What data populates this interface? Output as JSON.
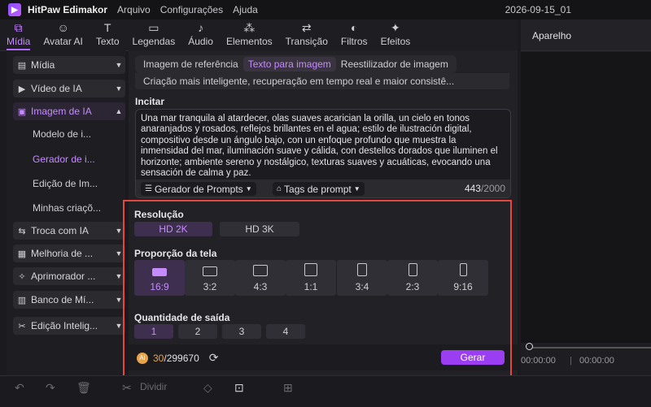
{
  "app": {
    "name": "HitPaw Edimakor",
    "menu": [
      "Arquivo",
      "Configurações",
      "Ajuda"
    ],
    "project": "2026-09-15_01"
  },
  "toolbar": [
    {
      "label": "Mídia",
      "icon": "media-icon",
      "active": true
    },
    {
      "label": "Avatar AI",
      "icon": "avatar-icon"
    },
    {
      "label": "Texto",
      "icon": "text-icon"
    },
    {
      "label": "Legendas",
      "icon": "subtitles-icon"
    },
    {
      "label": "Áudio",
      "icon": "audio-icon"
    },
    {
      "label": "Elementos",
      "icon": "elements-icon"
    },
    {
      "label": "Transição",
      "icon": "transition-icon"
    },
    {
      "label": "Filtros",
      "icon": "filters-icon"
    },
    {
      "label": "Efeitos",
      "icon": "effects-icon"
    }
  ],
  "sidebar": {
    "items": [
      {
        "label": "Mídia",
        "icon": "folder-icon"
      },
      {
        "label": "Vídeo de IA",
        "icon": "video-icon"
      },
      {
        "label": "Imagem de IA",
        "icon": "image-icon",
        "active": true
      },
      {
        "label": "Troca com IA",
        "icon": "swap-icon"
      },
      {
        "label": "Melhoria de ...",
        "icon": "enhance-icon"
      },
      {
        "label": "Aprimorador ...",
        "icon": "sparkle-icon"
      },
      {
        "label": "Banco de Mí...",
        "icon": "library-icon"
      },
      {
        "label": "Edição Intelig...",
        "icon": "smart-edit-icon"
      }
    ],
    "subitems": [
      {
        "label": "Modelo de i..."
      },
      {
        "label": "Gerador de i...",
        "active": true
      },
      {
        "label": "Edição de Im..."
      },
      {
        "label": "Minhas criaçõ..."
      }
    ]
  },
  "main": {
    "tabs": [
      "Imagem de referência",
      "Texto para imagem",
      "Reestilizador de imagem"
    ],
    "active_tab": 1,
    "tip": "Criação mais inteligente, recuperação em tempo real e maior consistê...",
    "prompt_label": "Incitar",
    "prompt_text": "Una mar tranquila al atardecer, olas suaves acarician la orilla, un cielo en tonos anaranjados y rosados, reflejos brillantes en el agua; estilo de ilustración digital, compositivo desde un ángulo bajo, con un enfoque profundo que muestra la inmensidad del mar, iluminación suave y cálida, con destellos dorados que iluminen el horizonte; ambiente sereno y nostálgico, texturas suaves y acuáticas, evocando una sensación de calma y paz.",
    "prompt_generator": "Gerador de Prompts",
    "prompt_tags": "Tags de prompt",
    "char_count": "443",
    "char_max": "/2000",
    "resolution_label": "Resolução",
    "resolutions": [
      "HD 2K",
      "HD 3K"
    ],
    "resolution_selected": 0,
    "aspect_label": "Proporção da tela",
    "aspects": [
      "16:9",
      "3:2",
      "4:3",
      "1:1",
      "3:4",
      "2:3",
      "9:16"
    ],
    "aspect_selected": 0,
    "quantity_label": "Quantidade de saída",
    "quantities": [
      "1",
      "2",
      "3",
      "4"
    ],
    "quantity_selected": 0,
    "credits_used": "30",
    "credits_total": "/299670",
    "generate_label": "Gerar"
  },
  "preview": {
    "title": "Aparelho",
    "time_current": "00:00:00",
    "time_total": "00:00:00"
  },
  "timeline": {
    "split_label": "Dividir"
  },
  "colors": {
    "accent": "#b06cff",
    "generate": "#9b3df0",
    "highlight_box": "#e5473e",
    "coin": "#e8a24a"
  }
}
